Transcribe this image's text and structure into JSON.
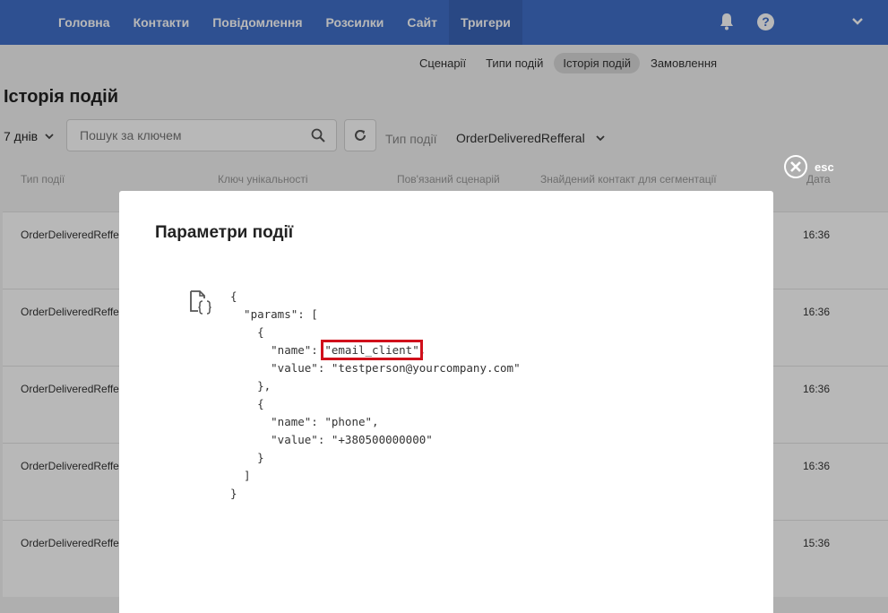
{
  "nav": {
    "items": [
      {
        "label": "Головна",
        "active": false
      },
      {
        "label": "Контакти",
        "active": false
      },
      {
        "label": "Повідомлення",
        "active": false
      },
      {
        "label": "Розсилки",
        "active": false
      },
      {
        "label": "Сайт",
        "active": false
      },
      {
        "label": "Тригери",
        "active": true
      }
    ],
    "help_glyph": "?"
  },
  "subtabs": [
    {
      "label": "Сценарії",
      "active": false
    },
    {
      "label": "Типи подій",
      "active": false
    },
    {
      "label": "Історія подій",
      "active": true
    },
    {
      "label": "Замовлення",
      "active": false
    }
  ],
  "page": {
    "title": "Історія подій"
  },
  "filters": {
    "period": "7 днів",
    "search_placeholder": "Пошук за ключем",
    "event_type_label": "Тип події",
    "event_type_value": "OrderDeliveredRefferal"
  },
  "table": {
    "headers": {
      "type": "Тип події",
      "key": "Ключ унікальності",
      "scenario": "Пов'язаний сценарій",
      "contact": "Знайдений контакт для сегментації",
      "date": "Дата"
    },
    "rows": [
      {
        "type": "OrderDeliveredRefferal",
        "time": "16:36"
      },
      {
        "type": "OrderDeliveredRefferal",
        "time": "16:36"
      },
      {
        "type": "OrderDeliveredRefferal",
        "time": "16:36"
      },
      {
        "type": "OrderDeliveredRefferal",
        "time": "16:36"
      },
      {
        "type": "OrderDeliveredRefferal",
        "time": "15:36"
      }
    ]
  },
  "modal": {
    "close_label": "esc",
    "title": "Параметри події",
    "code": {
      "l1": "{",
      "l2": "  \"params\": [",
      "l3": "    {",
      "l4_pre": "      \"name\": ",
      "l4_hl": "\"email_client\"",
      "l4_post": ",",
      "l5": "      \"value\": \"testperson@yourcompany.com\"",
      "l6": "    },",
      "l7": "    {",
      "l8": "      \"name\": \"phone\",",
      "l9": "      \"value\": \"+380500000000\"",
      "l10": "    }",
      "l11": "  ]",
      "l12": "}"
    },
    "highlight_color": "#d0101b"
  },
  "colors": {
    "brand": "#4170c9",
    "highlight": "#d0101b"
  }
}
